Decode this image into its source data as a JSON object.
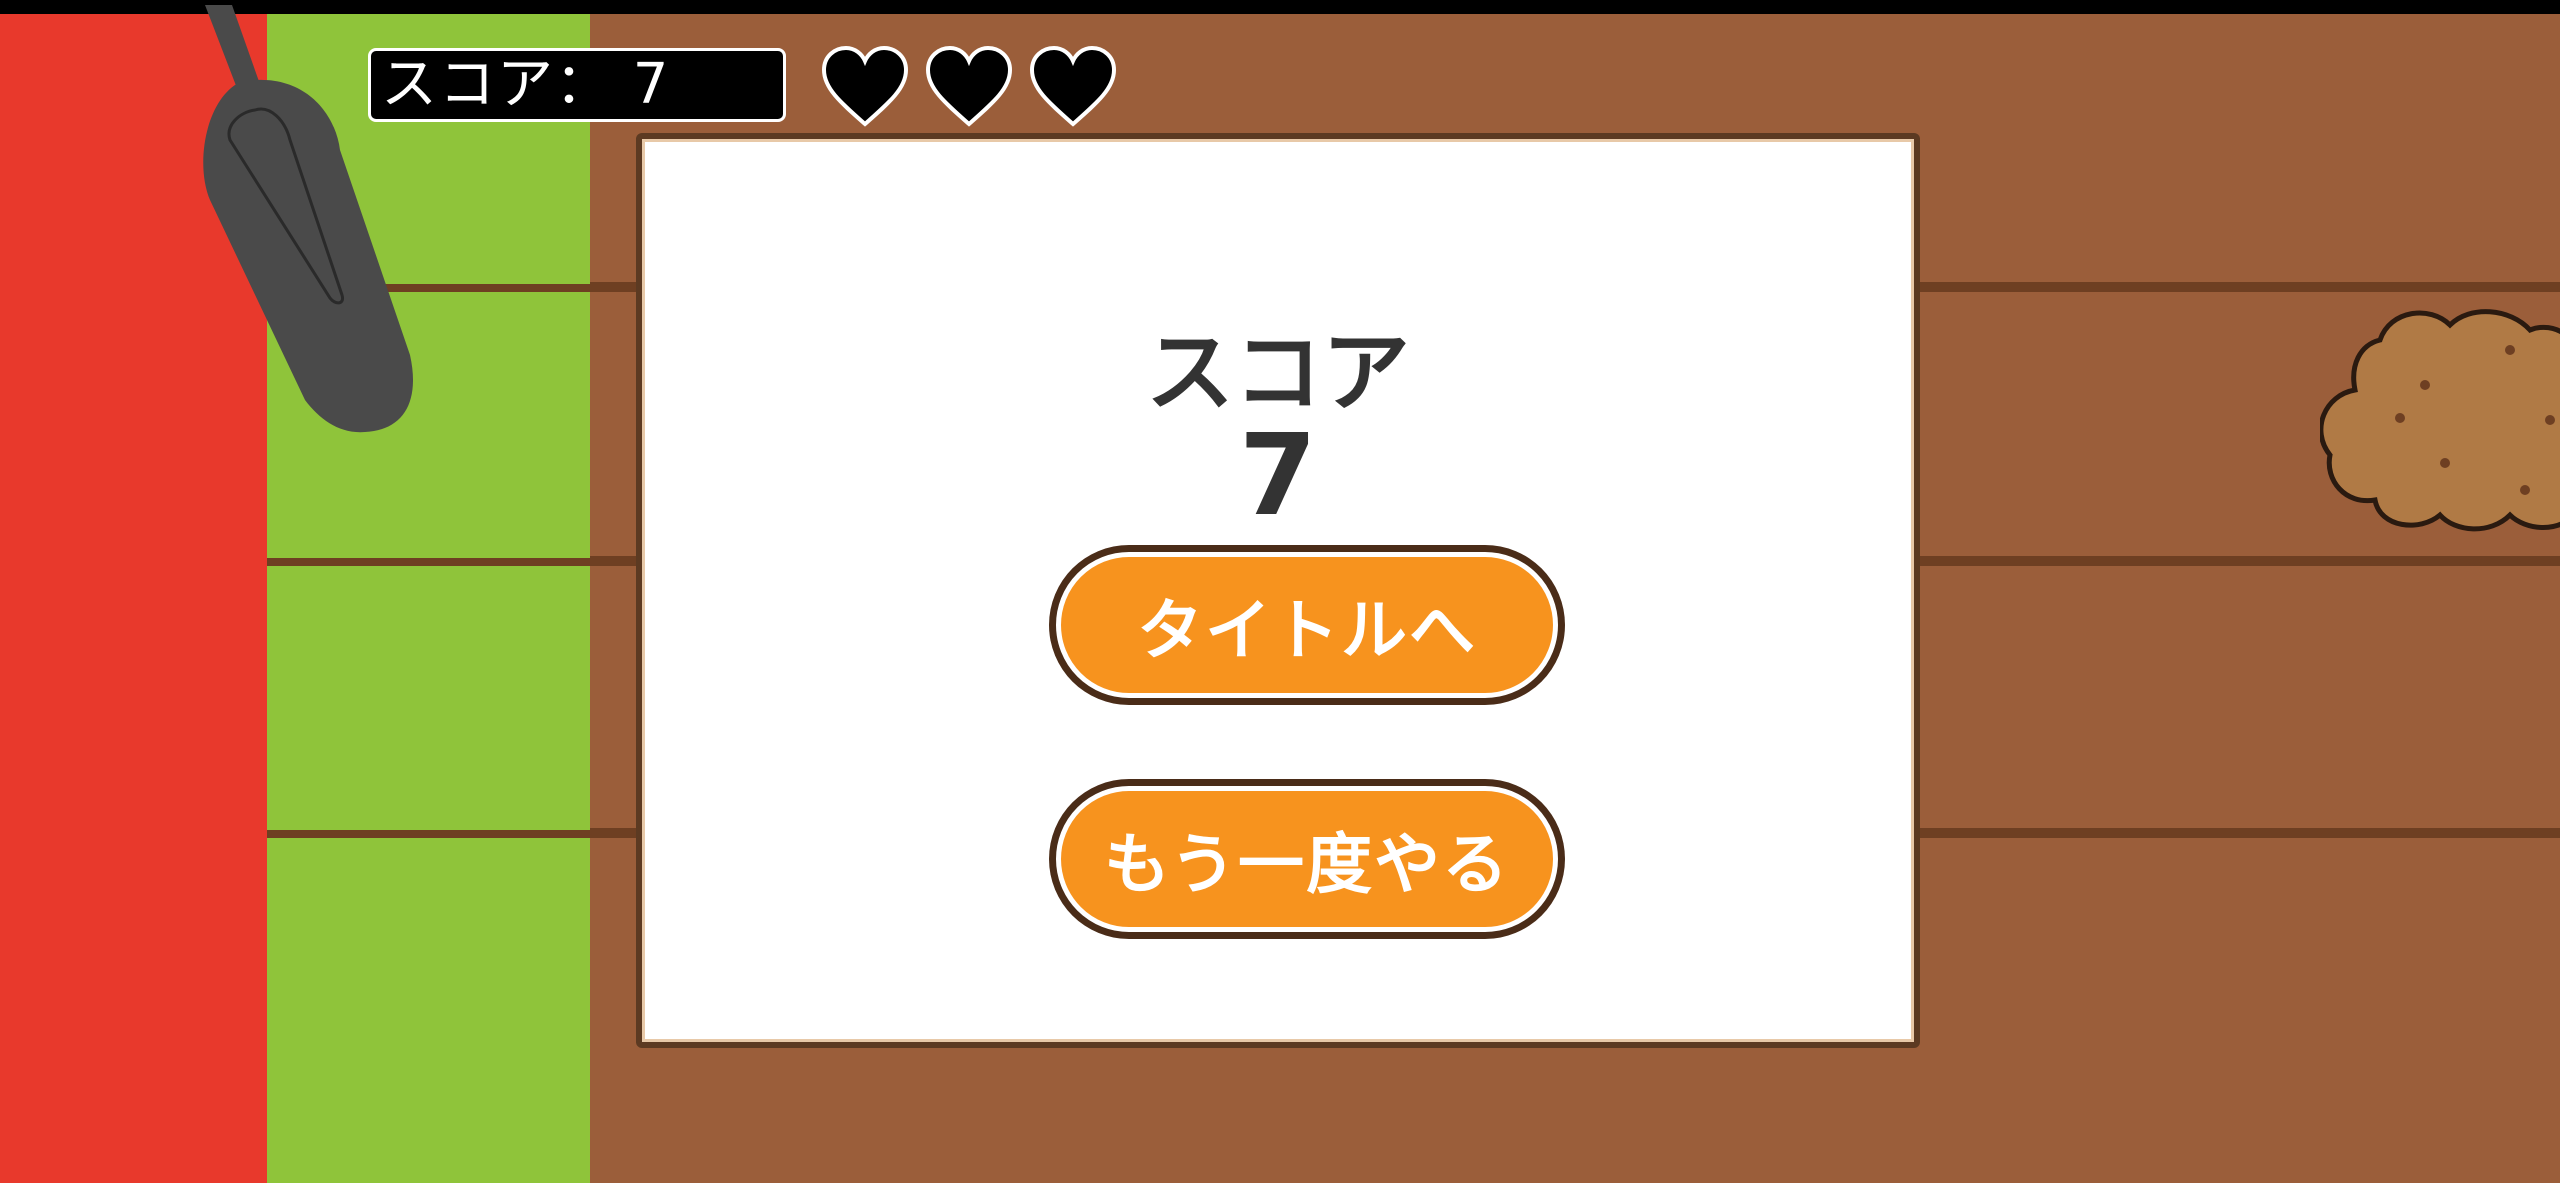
{
  "hud": {
    "score_label": "スコア： 7",
    "lives": 3
  },
  "dialog": {
    "score_heading": "スコア",
    "score_value": "7",
    "to_title_label": "タイトルへ",
    "retry_label": "もう一度やる"
  },
  "colors": {
    "red_lane": "#e8392c",
    "green_lane": "#8fc43a",
    "board": "#9b5e3a",
    "button": "#f7931e",
    "button_border": "#4a2c18",
    "text_dark": "#333333"
  },
  "icons": {
    "paddle": "spatula-icon",
    "cookie": "cookie-icon",
    "life": "heart-icon"
  }
}
